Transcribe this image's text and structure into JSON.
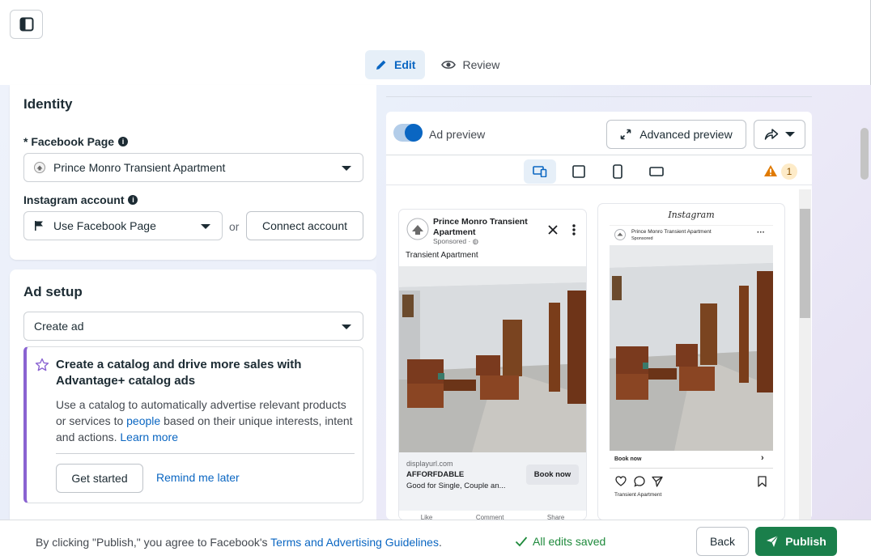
{
  "mode_tabs": [
    {
      "label": "Edit",
      "icon": "pencil-icon",
      "active": true
    },
    {
      "label": "Review",
      "icon": "eye-icon",
      "active": false
    }
  ],
  "identity": {
    "title": "Identity",
    "facebook_page_label": "* Facebook Page",
    "facebook_page_value": "Prince Monro Transient Apartment",
    "instagram_label": "Instagram account",
    "instagram_value": "Use Facebook Page",
    "or_text": "or",
    "connect_button": "Connect account"
  },
  "ad_setup": {
    "title": "Ad setup",
    "select_value": "Create ad",
    "promo": {
      "title": "Create a catalog and drive more sales with Advantage+ catalog ads",
      "body_1": "Use a catalog to automatically advertise relevant products or services to ",
      "body_link_1": "people",
      "body_2": " based on their unique interests, intent and actions. ",
      "body_link_2": "Learn more",
      "primary_button": "Get started",
      "secondary_link": "Remind me later"
    }
  },
  "preview": {
    "toggle_label": "Ad preview",
    "toggle_on": true,
    "advanced_button": "Advanced preview",
    "warning_count": "1",
    "devices": [
      "multi-device-icon",
      "square-icon",
      "phone-icon",
      "landscape-icon"
    ],
    "facebook_ad": {
      "page_name": "Prince Monro Transient Apartment",
      "sponsored": "Sponsored · ",
      "primary_text": "Transient Apartment",
      "display_url": "displayurl.com",
      "headline": "AFFORFDABLE",
      "description": "Good for Single, Couple an...",
      "cta": "Book now",
      "actions": [
        "Like",
        "Comment",
        "Share"
      ]
    },
    "instagram_ad": {
      "app_name": "Instagram",
      "page_name": "Prince Monro Transient Apartment",
      "sponsored": "Sponsored",
      "cta": "Book now",
      "caption": "Transient Apartment"
    }
  },
  "footer": {
    "terms_prefix": "By clicking \"Publish,\" you agree to Facebook's ",
    "terms_link": "Terms and Advertising Guidelines",
    "terms_suffix": ".",
    "saved_status": "All edits saved",
    "back_button": "Back",
    "publish_button": "Publish"
  },
  "colors": {
    "primary_blue": "#0a66c2",
    "publish_green": "#1a7f4b",
    "saved_green": "#1f8a3c",
    "promo_accent": "#8a63d2",
    "warning_orange": "#e07a00"
  }
}
